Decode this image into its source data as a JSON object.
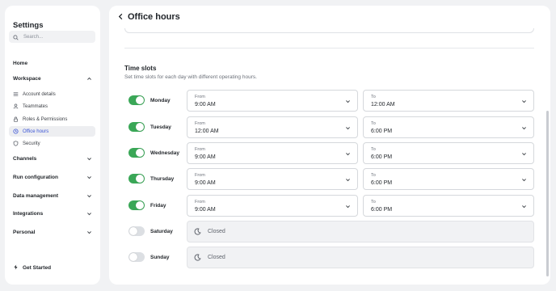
{
  "sidebar": {
    "title": "Settings",
    "search_placeholder": "Search...",
    "home": "Home",
    "workspace": {
      "label": "Workspace",
      "items": [
        {
          "label": "Account details",
          "icon": "list-icon"
        },
        {
          "label": "Teammates",
          "icon": "person-icon"
        },
        {
          "label": "Roles & Permissions",
          "icon": "lock-icon"
        },
        {
          "label": "Office hours",
          "icon": "clock-icon",
          "active": true
        },
        {
          "label": "Security",
          "icon": "shield-icon"
        }
      ]
    },
    "groups": [
      "Channels",
      "Run configuration",
      "Data management",
      "Integrations",
      "Personal"
    ],
    "get_started": "Get Started"
  },
  "header": {
    "title": "Office hours"
  },
  "time_slots": {
    "title": "Time slots",
    "subtitle": "Set time slots for each day with different operating hours.",
    "from_label": "From",
    "to_label": "To",
    "closed_label": "Closed",
    "days": [
      {
        "day": "Monday",
        "enabled": true,
        "from": "9:00 AM",
        "to": "12:00 AM"
      },
      {
        "day": "Tuesday",
        "enabled": true,
        "from": "12:00 AM",
        "to": "6:00 PM"
      },
      {
        "day": "Wednesday",
        "enabled": true,
        "from": "9:00 AM",
        "to": "6:00 PM"
      },
      {
        "day": "Thursday",
        "enabled": true,
        "from": "9:00 AM",
        "to": "6:00 PM"
      },
      {
        "day": "Friday",
        "enabled": true,
        "from": "9:00 AM",
        "to": "6:00 PM"
      },
      {
        "day": "Saturday",
        "enabled": false
      },
      {
        "day": "Sunday",
        "enabled": false
      }
    ]
  },
  "colors": {
    "accent": "#3a54d6",
    "toggle_on": "#3aa757",
    "toggle_off": "#dcdfe3",
    "background": "#f1f2f4"
  }
}
